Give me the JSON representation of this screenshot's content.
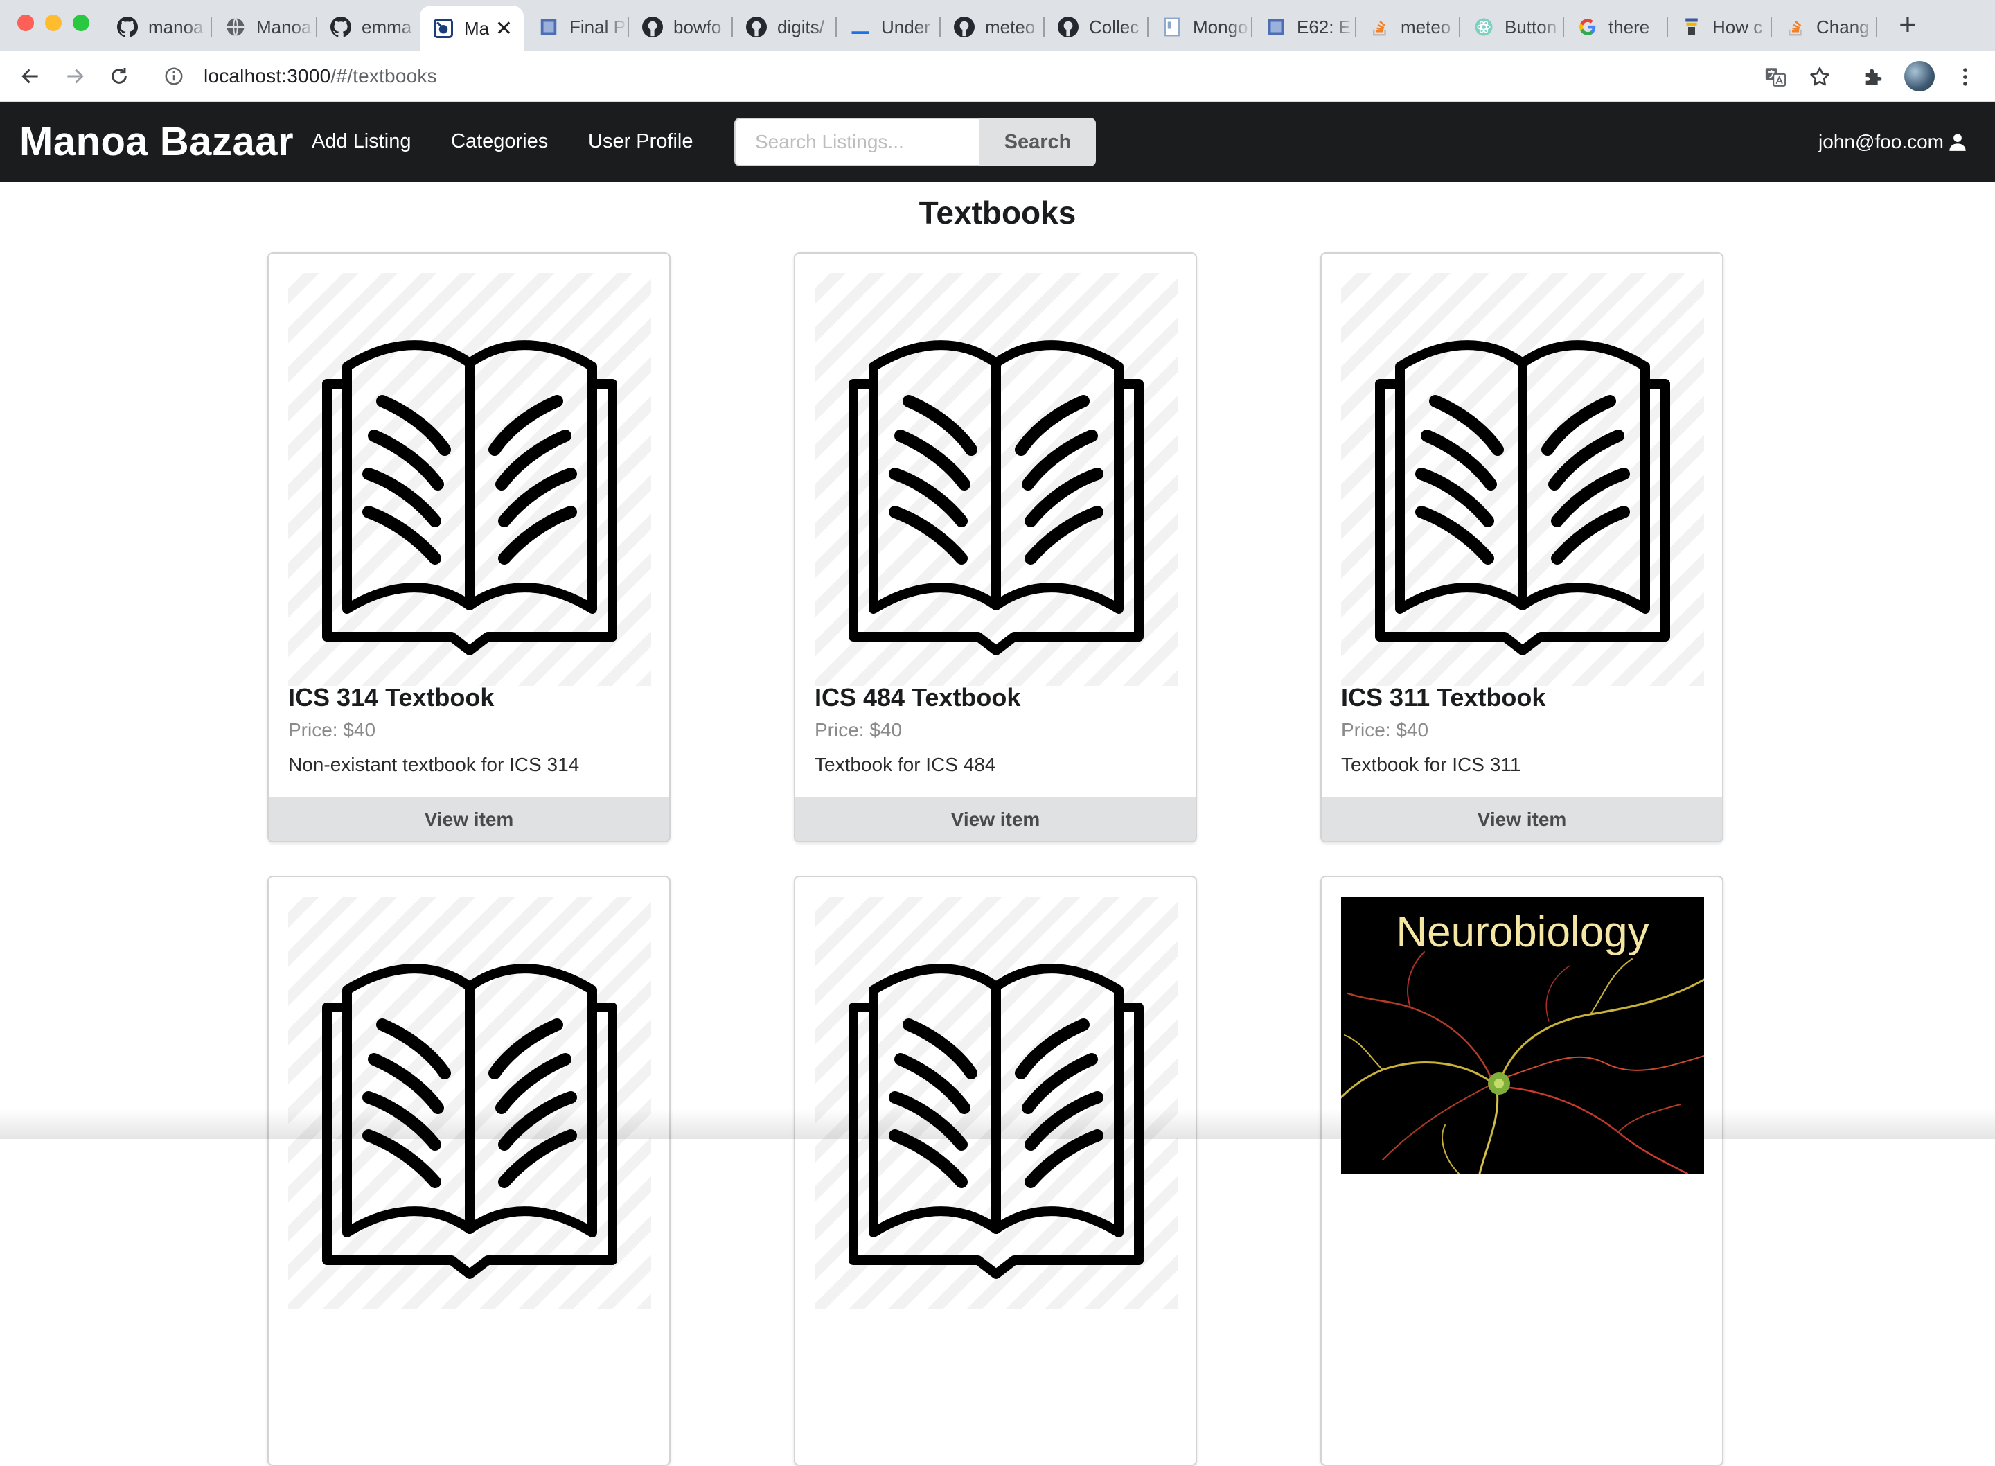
{
  "browser": {
    "tabs": [
      {
        "icon": "github-icon",
        "title": "manoa"
      },
      {
        "icon": "globe-icon",
        "title": "Manoa"
      },
      {
        "icon": "github-icon",
        "title": "emma"
      },
      {
        "icon": "meteor-app-icon",
        "title": "Ma",
        "active": true
      },
      {
        "icon": "doc-icon",
        "title": "Final P"
      },
      {
        "icon": "github-icon",
        "title": "bowfo"
      },
      {
        "icon": "github-icon",
        "title": "digits/"
      },
      {
        "icon": "underline-icon",
        "title": "Under"
      },
      {
        "icon": "github-icon",
        "title": "meteo"
      },
      {
        "icon": "github-icon",
        "title": "Collec"
      },
      {
        "icon": "page-icon",
        "title": "Mongo"
      },
      {
        "icon": "doc-icon",
        "title": "E62: E"
      },
      {
        "icon": "stackoverflow-icon",
        "title": "meteo"
      },
      {
        "icon": "react-icon",
        "title": "Button"
      },
      {
        "icon": "google-icon",
        "title": "there"
      },
      {
        "icon": "bookmark-icon",
        "title": "How c"
      },
      {
        "icon": "stackoverflow-icon",
        "title": "Chang"
      }
    ],
    "url_host": "localhost:3000",
    "url_path": "/#/textbooks"
  },
  "navbar": {
    "brand": "Manoa Bazaar",
    "links": [
      "Add Listing",
      "Categories",
      "User Profile"
    ],
    "search_placeholder": "Search Listings...",
    "search_button": "Search",
    "user": "john@foo.com"
  },
  "page": {
    "title": "Textbooks"
  },
  "listings": [
    {
      "title": "ICS 314 Textbook",
      "price": "Price: $40",
      "description": "Non-existant textbook for ICS 314",
      "button": "View item"
    },
    {
      "title": "ICS 484 Textbook",
      "price": "Price: $40",
      "description": "Textbook for ICS 484",
      "button": "View item"
    },
    {
      "title": "ICS 311 Textbook",
      "price": "Price: $40",
      "description": "Textbook for ICS 311",
      "button": "View item"
    },
    {},
    {},
    {
      "cover_text": "Neurobiology"
    }
  ]
}
